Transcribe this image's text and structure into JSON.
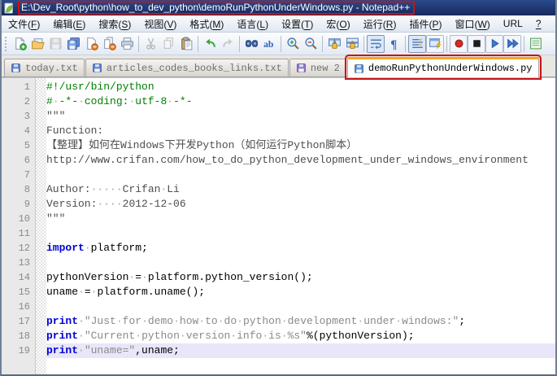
{
  "window": {
    "title": "E:\\Dev_Root\\python\\how_to_dev_python\\demoRunPythonUnderWindows.py - Notepad++",
    "title_highlighted": true
  },
  "menu": {
    "items": [
      "文件(F)",
      "编辑(E)",
      "搜索(S)",
      "视图(V)",
      "格式(M)",
      "语言(L)",
      "设置(T)",
      "宏(O)",
      "运行(R)",
      "插件(P)",
      "窗口(W)",
      "URL",
      "?"
    ]
  },
  "toolbar": {
    "items": [
      {
        "icon": "new-file",
        "name": "new-file",
        "state": ""
      },
      {
        "icon": "open-folder",
        "name": "open-file",
        "state": ""
      },
      {
        "icon": "save",
        "name": "save-file",
        "state": "disabled"
      },
      {
        "icon": "save-all",
        "name": "save-all",
        "state": ""
      },
      {
        "icon": "close-file",
        "name": "close-file",
        "state": ""
      },
      {
        "icon": "close-all",
        "name": "close-all",
        "state": ""
      },
      {
        "icon": "print",
        "name": "print",
        "state": ""
      },
      "|",
      {
        "icon": "cut",
        "name": "cut",
        "state": "disabled"
      },
      {
        "icon": "copy",
        "name": "copy",
        "state": "disabled"
      },
      {
        "icon": "paste",
        "name": "paste",
        "state": ""
      },
      "|",
      {
        "icon": "undo",
        "name": "undo",
        "state": ""
      },
      {
        "icon": "redo",
        "name": "redo",
        "state": "disabled"
      },
      "|",
      {
        "icon": "find",
        "name": "find",
        "state": ""
      },
      {
        "icon": "replace",
        "name": "find-replace",
        "state": ""
      },
      "|",
      {
        "icon": "zoom-in",
        "name": "zoom-in",
        "state": ""
      },
      {
        "icon": "zoom-out",
        "name": "zoom-out",
        "state": ""
      },
      "|",
      {
        "icon": "sync-v",
        "name": "sync-vertical-scroll",
        "state": ""
      },
      {
        "icon": "sync-h",
        "name": "sync-horizontal-scroll",
        "state": ""
      },
      "|",
      {
        "icon": "word-wrap",
        "name": "word-wrap",
        "state": "pressed"
      },
      {
        "icon": "paragraph",
        "name": "show-paragraph-marks",
        "state": ""
      },
      "|",
      {
        "icon": "show-all-chars",
        "name": "show-all-characters",
        "state": "pressed"
      },
      {
        "icon": "user-dlg",
        "name": "user-defined-dialog",
        "state": "framed"
      },
      "|",
      {
        "icon": "record",
        "name": "macro-record",
        "state": "framed"
      },
      {
        "icon": "stop",
        "name": "macro-stop",
        "state": "framed"
      },
      {
        "icon": "play",
        "name": "macro-playback",
        "state": "framed"
      },
      {
        "icon": "play-multi",
        "name": "macro-run-multiple",
        "state": "framed"
      },
      "|",
      {
        "icon": "doc-switcher",
        "name": "doc-switcher",
        "state": ""
      }
    ]
  },
  "tabs": [
    {
      "label": "today.txt",
      "active": false,
      "highlighted": false,
      "icon_color": "#5b7fd9"
    },
    {
      "label": "articles_codes_books_links.txt",
      "active": false,
      "highlighted": false,
      "icon_color": "#5b7fd9"
    },
    {
      "label": "new  2",
      "active": false,
      "highlighted": false,
      "icon_color": "#9a6fd0"
    },
    {
      "label": "demoRunPythonUnderWindows.py",
      "active": true,
      "highlighted": true,
      "icon_color": "#4f8fd0"
    }
  ],
  "editor": {
    "current_line": 19,
    "lines": [
      {
        "num": 1,
        "segments": [
          {
            "t": "#!/usr/bin/python",
            "s": "comment"
          }
        ]
      },
      {
        "num": 2,
        "segments": [
          {
            "t": "# -*- coding: utf-8 -*-",
            "s": "comment"
          }
        ]
      },
      {
        "num": 3,
        "segments": [
          {
            "t": "\"\"\"",
            "s": "docstring"
          }
        ]
      },
      {
        "num": 4,
        "segments": [
          {
            "t": "Function:",
            "s": "docstring"
          }
        ]
      },
      {
        "num": 5,
        "segments": [
          {
            "t": "【整理】如何在Windows下开发Python（如何运行Python脚本）",
            "s": "docstring"
          }
        ]
      },
      {
        "num": 6,
        "segments": [
          {
            "t": "http://www.crifan.com/how_to_do_python_development_under_windows_environment",
            "s": "docstring"
          }
        ]
      },
      {
        "num": 7,
        "segments": []
      },
      {
        "num": 8,
        "segments": [
          {
            "t": "Author:     Crifan Li",
            "s": "docstring"
          }
        ]
      },
      {
        "num": 9,
        "segments": [
          {
            "t": "Version:    2012-12-06",
            "s": "docstring"
          }
        ]
      },
      {
        "num": 10,
        "segments": [
          {
            "t": "\"\"\"",
            "s": "docstring"
          }
        ]
      },
      {
        "num": 11,
        "segments": []
      },
      {
        "num": 12,
        "segments": [
          {
            "t": "import",
            "s": "keyword"
          },
          {
            "t": " platform;",
            "s": "plain"
          }
        ]
      },
      {
        "num": 13,
        "segments": []
      },
      {
        "num": 14,
        "segments": [
          {
            "t": "pythonVersion = platform.python_version();",
            "s": "plain"
          }
        ]
      },
      {
        "num": 15,
        "segments": [
          {
            "t": "uname = platform.uname();",
            "s": "plain"
          }
        ]
      },
      {
        "num": 16,
        "segments": []
      },
      {
        "num": 17,
        "segments": [
          {
            "t": "print",
            "s": "keyword"
          },
          {
            "t": " ",
            "s": "plain"
          },
          {
            "t": "\"Just for demo how to do python development under windows:\"",
            "s": "string"
          },
          {
            "t": ";",
            "s": "plain"
          }
        ]
      },
      {
        "num": 18,
        "segments": [
          {
            "t": "print",
            "s": "keyword"
          },
          {
            "t": " ",
            "s": "plain"
          },
          {
            "t": "\"Current python version info is %s\"",
            "s": "string"
          },
          {
            "t": "%(pythonVersion);",
            "s": "plain"
          }
        ]
      },
      {
        "num": 19,
        "segments": [
          {
            "t": "print",
            "s": "keyword"
          },
          {
            "t": " ",
            "s": "plain"
          },
          {
            "t": "\"uname=\"",
            "s": "string"
          },
          {
            "t": ",uname;",
            "s": "plain"
          }
        ]
      }
    ]
  },
  "colors": {
    "accent_orange": "#f5a623",
    "highlight_red": "#cc1111",
    "keyword_blue": "#0000d8",
    "comment_green": "#008000",
    "string_gray": "#8a8a8a",
    "docstring_gray": "#4e4e4e",
    "current_line_bg": "#e8e6f8",
    "titlebar_blue": "#1f3a74",
    "active_tab_bg": "#fdfdfd"
  }
}
